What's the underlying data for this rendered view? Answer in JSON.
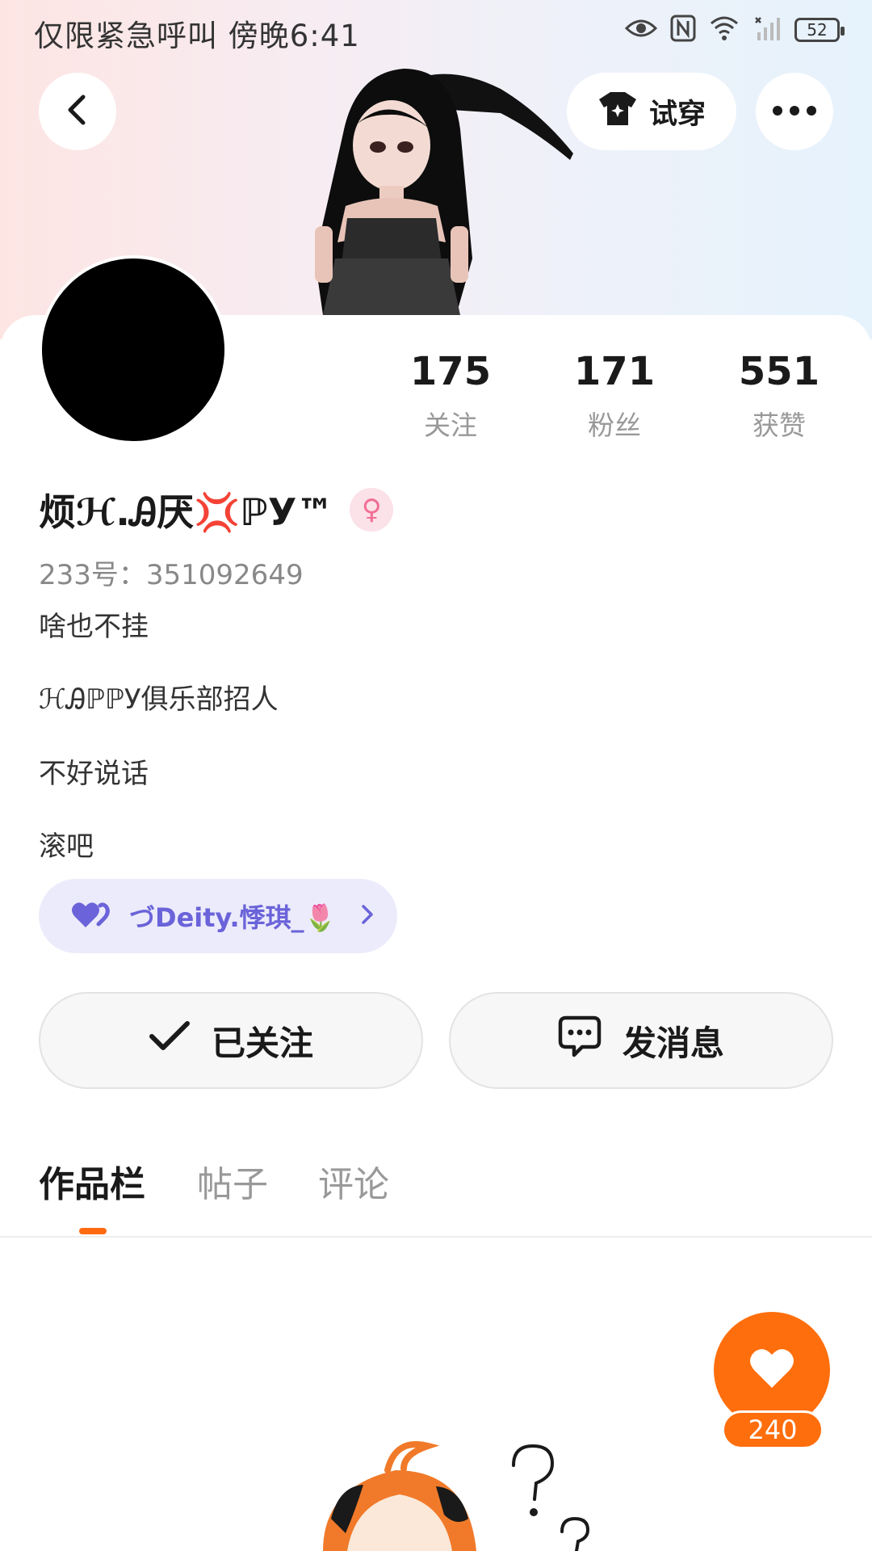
{
  "status_bar": {
    "text": "仅限紧急呼叫 傍晚6:41",
    "battery": "52"
  },
  "header": {
    "try_on_label": "试穿"
  },
  "stats": [
    {
      "value": "175",
      "label": "关注"
    },
    {
      "value": "171",
      "label": "粉丝"
    },
    {
      "value": "551",
      "label": "获赞"
    }
  ],
  "profile": {
    "username": "烦ℋ.Ꭿ厌💢ℙУ™",
    "gender_symbol": "♀",
    "id_text": "233号：351092649",
    "bio_lines": [
      "啥也不挂",
      "ℋᎯℙℙУ俱乐部招人",
      "不好说话",
      "滚吧"
    ]
  },
  "guild": {
    "name": "づDeity.悸琪_🌷"
  },
  "actions": {
    "follow_label": "已关注",
    "message_label": "发消息"
  },
  "tabs": [
    {
      "label": "作品栏",
      "active": true
    },
    {
      "label": "帖子",
      "active": false
    },
    {
      "label": "评论",
      "active": false
    }
  ],
  "like": {
    "count": "240"
  },
  "colors": {
    "accent": "#ff6e0c",
    "guild_text": "#6a63d9",
    "guild_bg": "#ecebfb"
  }
}
